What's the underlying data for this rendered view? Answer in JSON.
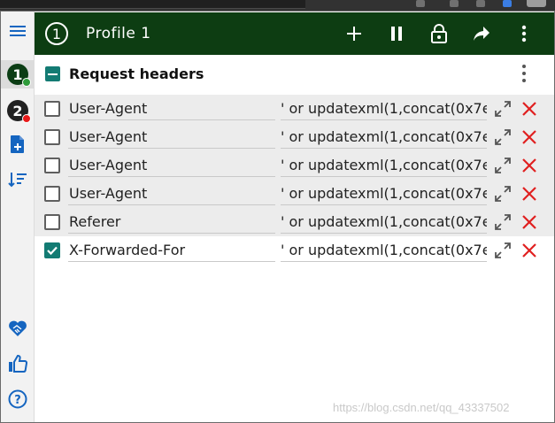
{
  "sidebar": {
    "profiles": [
      {
        "number": "1",
        "status_color": "#2e9b3a"
      },
      {
        "number": "2",
        "status_color": "#e81a1a"
      }
    ]
  },
  "header": {
    "profile_number": "1",
    "title": "Profile 1",
    "background": "#0d3d12"
  },
  "section": {
    "title": "Request headers"
  },
  "rows": [
    {
      "enabled": false,
      "name": "User-Agent",
      "value": "' or updatexml(1,concat(0x7e"
    },
    {
      "enabled": false,
      "name": "User-Agent",
      "value": "' or updatexml(1,concat(0x7e"
    },
    {
      "enabled": false,
      "name": "User-Agent",
      "value": "' or updatexml(1,concat(0x7e"
    },
    {
      "enabled": false,
      "name": "User-Agent",
      "value": "' or updatexml(1,concat(0x7e"
    },
    {
      "enabled": false,
      "name": "Referer",
      "value": "' or updatexml(1,concat(0x7e"
    },
    {
      "enabled": true,
      "name": "X-Forwarded-For",
      "value": "' or updatexml(1,concat(0x7e"
    }
  ],
  "watermark": "https://blog.csdn.net/qq_43337502",
  "colors": {
    "accent_teal": "#137b73",
    "delete_red": "#e02020",
    "sidebar_blue": "#1565c0"
  }
}
